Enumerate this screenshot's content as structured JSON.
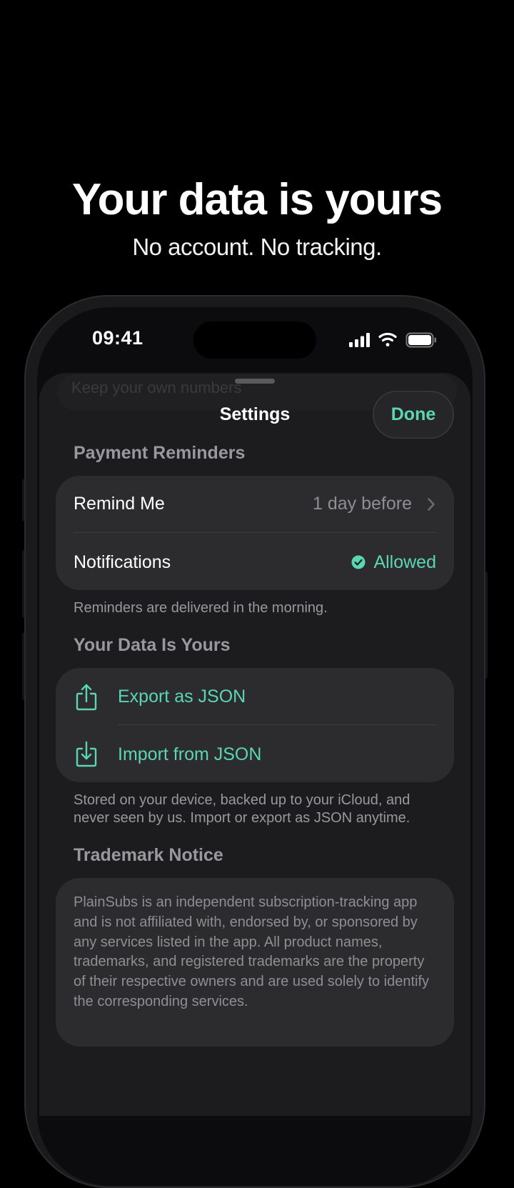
{
  "hero": {
    "title": "Your data is yours",
    "subtitle": "No account. No tracking."
  },
  "status_bar": {
    "time": "09:41",
    "icons": [
      "signal-icon",
      "wifi-icon",
      "battery-icon"
    ]
  },
  "sheet": {
    "title": "Settings",
    "done_label": "Done",
    "behind_text": "Keep your own numbers"
  },
  "payment_reminders": {
    "header": "Payment Reminders",
    "rows": [
      {
        "label": "Remind Me",
        "value": "1 day before"
      },
      {
        "label": "Notifications",
        "value": "Allowed"
      }
    ],
    "footer": "Reminders are delivered in the morning."
  },
  "your_data": {
    "header": "Your Data Is Yours",
    "rows": [
      {
        "label": "Export as JSON",
        "icon": "share-upload-icon"
      },
      {
        "label": "Import from JSON",
        "icon": "download-tray-icon"
      }
    ],
    "footer_line1": "Stored on your device, backed up to your iCloud, and",
    "footer_line2": "never seen by us. Import or export as JSON anytime."
  },
  "trademark": {
    "header": "Trademark Notice",
    "body": "PlainSubs is an independent subscription-tracking app and is not affiliated with, endorsed by, or sponsored by any services listed in the app. All product names, trademarks, and registered trademarks are the property of their respective owners and are used solely to identify the corresponding services."
  },
  "colors": {
    "accent": "#5ad6b0",
    "background": "#000000",
    "sheet": "#1c1c1e",
    "group": "#2c2c2e",
    "secondary_text": "#8e8e93"
  }
}
